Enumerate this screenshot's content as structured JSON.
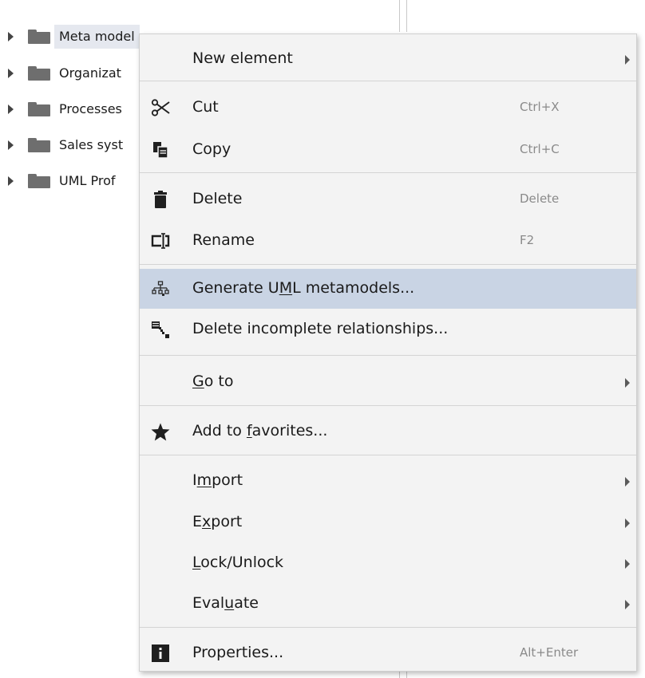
{
  "tree": {
    "items": [
      {
        "label": "Meta model",
        "selected": true
      },
      {
        "label": "Organizat"
      },
      {
        "label": "Processes"
      },
      {
        "label": "Sales syst"
      },
      {
        "label": "UML Prof"
      }
    ]
  },
  "menu": {
    "items": [
      {
        "label": "New element",
        "shortcut": "",
        "icon": "none",
        "submenu": true
      },
      {
        "label": "Cut",
        "shortcut": "Ctrl+X",
        "icon": "scissors-icon"
      },
      {
        "label": "Copy",
        "shortcut": "Ctrl+C",
        "icon": "copy-icon"
      },
      {
        "label": "Delete",
        "shortcut": "Delete",
        "icon": "trash-icon"
      },
      {
        "label": "Rename",
        "shortcut": "F2",
        "icon": "rename-icon"
      },
      {
        "label_pre": "Generate U",
        "label_ul": "M",
        "label_post": "L metamodels...",
        "shortcut": "",
        "icon": "hierarchy-icon",
        "hover": true
      },
      {
        "label": "Delete incomplete relationships...",
        "shortcut": "",
        "icon": "delete-relationships-icon"
      },
      {
        "label_pre": "",
        "label_ul": "G",
        "label_post": "o to",
        "icon": "none",
        "submenu": true
      },
      {
        "label_pre": "Add to ",
        "label_ul": "f",
        "label_post": "avorites...",
        "icon": "star-icon"
      },
      {
        "label_pre": "I",
        "label_ul": "m",
        "label_post": "port",
        "icon": "none",
        "submenu": true
      },
      {
        "label_pre": "E",
        "label_ul": "x",
        "label_post": "port",
        "icon": "none",
        "submenu": true
      },
      {
        "label_pre": "",
        "label_ul": "L",
        "label_post": "ock/Unlock",
        "icon": "none",
        "submenu": true
      },
      {
        "label_pre": "Eval",
        "label_ul": "u",
        "label_post": "ate",
        "icon": "none",
        "submenu": true
      },
      {
        "label": "Properties...",
        "shortcut": "Alt+Enter",
        "icon": "info-icon"
      }
    ]
  },
  "colors": {
    "hover": "#c9d4e4",
    "menu_bg": "#f3f3f3",
    "shortcut": "#8a8a8a"
  }
}
